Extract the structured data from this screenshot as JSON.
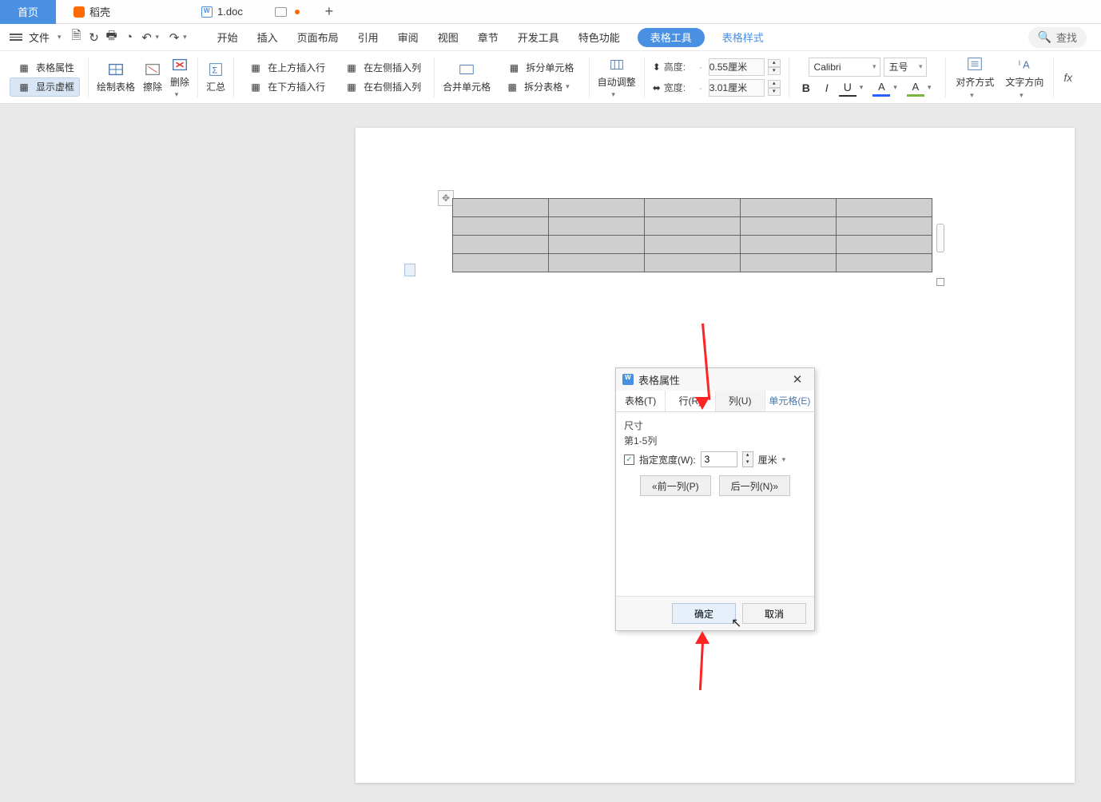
{
  "tabs": {
    "home": "首页",
    "daoke": "稻壳",
    "doc": "1.doc"
  },
  "menubar": {
    "file": "文件",
    "items": [
      "开始",
      "插入",
      "页面布局",
      "引用",
      "审阅",
      "视图",
      "章节",
      "开发工具",
      "特色功能"
    ],
    "table_tools": "表格工具",
    "table_style": "表格样式",
    "search": "查找"
  },
  "ribbon": {
    "table_props": "表格属性",
    "show_grid": "显示虚框",
    "draw_table": "绘制表格",
    "eraser": "擦除",
    "delete": "删除",
    "summary": "汇总",
    "insert_row_above": "在上方插入行",
    "insert_row_below": "在下方插入行",
    "insert_col_left": "在左侧插入列",
    "insert_col_right": "在右侧插入列",
    "merge_cells": "合并单元格",
    "split_cells": "拆分单元格",
    "split_table": "拆分表格",
    "auto_fit": "自动调整",
    "height_label": "高度:",
    "height_value": "0.55厘米",
    "width_label": "宽度:",
    "width_value": "3.01厘米",
    "font_name": "Calibri",
    "font_size": "五号",
    "align": "对齐方式",
    "text_dir": "文字方向",
    "fx": "fx"
  },
  "dialog": {
    "title": "表格属性",
    "tabs": {
      "table": "表格(T)",
      "row": "行(R)",
      "col": "列(U)",
      "cell": "单元格(E)"
    },
    "size_label": "尺寸",
    "range_label": "第1-5列",
    "spec_width_label": "指定宽度(W):",
    "width_value": "3",
    "unit_label": "厘米",
    "prev_col": "«前一列(P)",
    "next_col": "后一列(N)»",
    "ok": "确定",
    "cancel": "取消"
  }
}
